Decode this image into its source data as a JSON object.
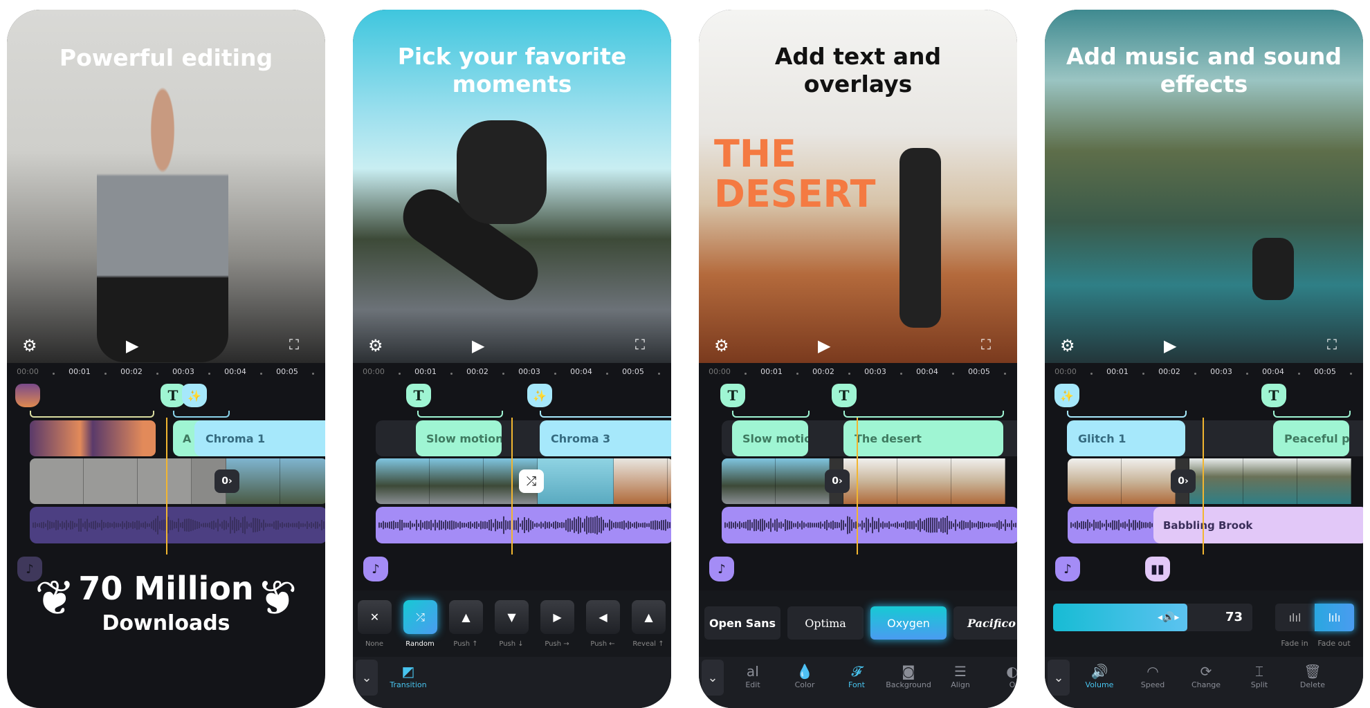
{
  "timeline_ticks": [
    "00:00",
    "00:01",
    "00:02",
    "00:03",
    "00:04",
    "00:05"
  ],
  "colors": {
    "text_clip": "#9ff5d3",
    "effect_clip": "#a6e8fb",
    "audio": "#a48cf6",
    "playhead": "#f2b630",
    "accent": "#48c4ef",
    "desert_title": "#f47a42"
  },
  "card1": {
    "headline": "Powerful editing",
    "clips": {
      "text_partial": "A",
      "effect": "Chroma 1"
    },
    "badge": {
      "line1": "70 Million",
      "line2": "Downloads"
    }
  },
  "card2": {
    "headline": [
      "Pick your favorite",
      "moments"
    ],
    "clips": {
      "text": "Slow motion",
      "effect": "Chroma 3"
    },
    "transitions": [
      {
        "label": "None",
        "icon": "close-icon",
        "glyph": "✕"
      },
      {
        "label": "Random",
        "icon": "shuffle-icon",
        "glyph": "⤮",
        "selected": true
      },
      {
        "label": "Push ↑",
        "icon": "arrow-up-icon",
        "glyph": "▲"
      },
      {
        "label": "Push ↓",
        "icon": "arrow-down-icon",
        "glyph": "▼"
      },
      {
        "label": "Push →",
        "icon": "arrow-right-icon",
        "glyph": "▶"
      },
      {
        "label": "Push ←",
        "icon": "arrow-left-icon",
        "glyph": "◀"
      },
      {
        "label": "Reveal ↑",
        "icon": "arrow-up-icon",
        "glyph": "▲"
      }
    ],
    "tab": "Transition"
  },
  "card3": {
    "headline": [
      "Add text and",
      "overlays"
    ],
    "overlay_title": [
      "THE",
      "DESERT"
    ],
    "clips": {
      "text1": "Slow motion",
      "text2": "The desert"
    },
    "fonts": [
      {
        "label": "Open Sans"
      },
      {
        "label": "Optima"
      },
      {
        "label": "Oxygen",
        "selected": true
      },
      {
        "label": "Pacifico"
      }
    ],
    "tabs": [
      {
        "label": "Edit",
        "glyph": "aI"
      },
      {
        "label": "Color",
        "glyph": "💧"
      },
      {
        "label": "Font",
        "glyph": "𝓕",
        "active": true
      },
      {
        "label": "Background",
        "glyph": "◙"
      },
      {
        "label": "Align",
        "glyph": "☰"
      },
      {
        "label": "O",
        "glyph": "◐"
      }
    ]
  },
  "card4": {
    "headline": [
      "Add music and sound",
      "effects"
    ],
    "clips": {
      "effect": "Glitch 1",
      "text": "Peaceful pl",
      "audio": "Babbling Brook"
    },
    "volume": 73,
    "volume_label": "73",
    "fade": [
      {
        "label": "Fade in"
      },
      {
        "label": "Fade out",
        "selected": true
      }
    ],
    "tabs": [
      {
        "label": "Volume",
        "glyph": "🔊",
        "active": true
      },
      {
        "label": "Speed",
        "glyph": "◠"
      },
      {
        "label": "Change",
        "glyph": "⟳"
      },
      {
        "label": "Split",
        "glyph": "⌶"
      },
      {
        "label": "Delete",
        "glyph": "🗑"
      }
    ]
  }
}
